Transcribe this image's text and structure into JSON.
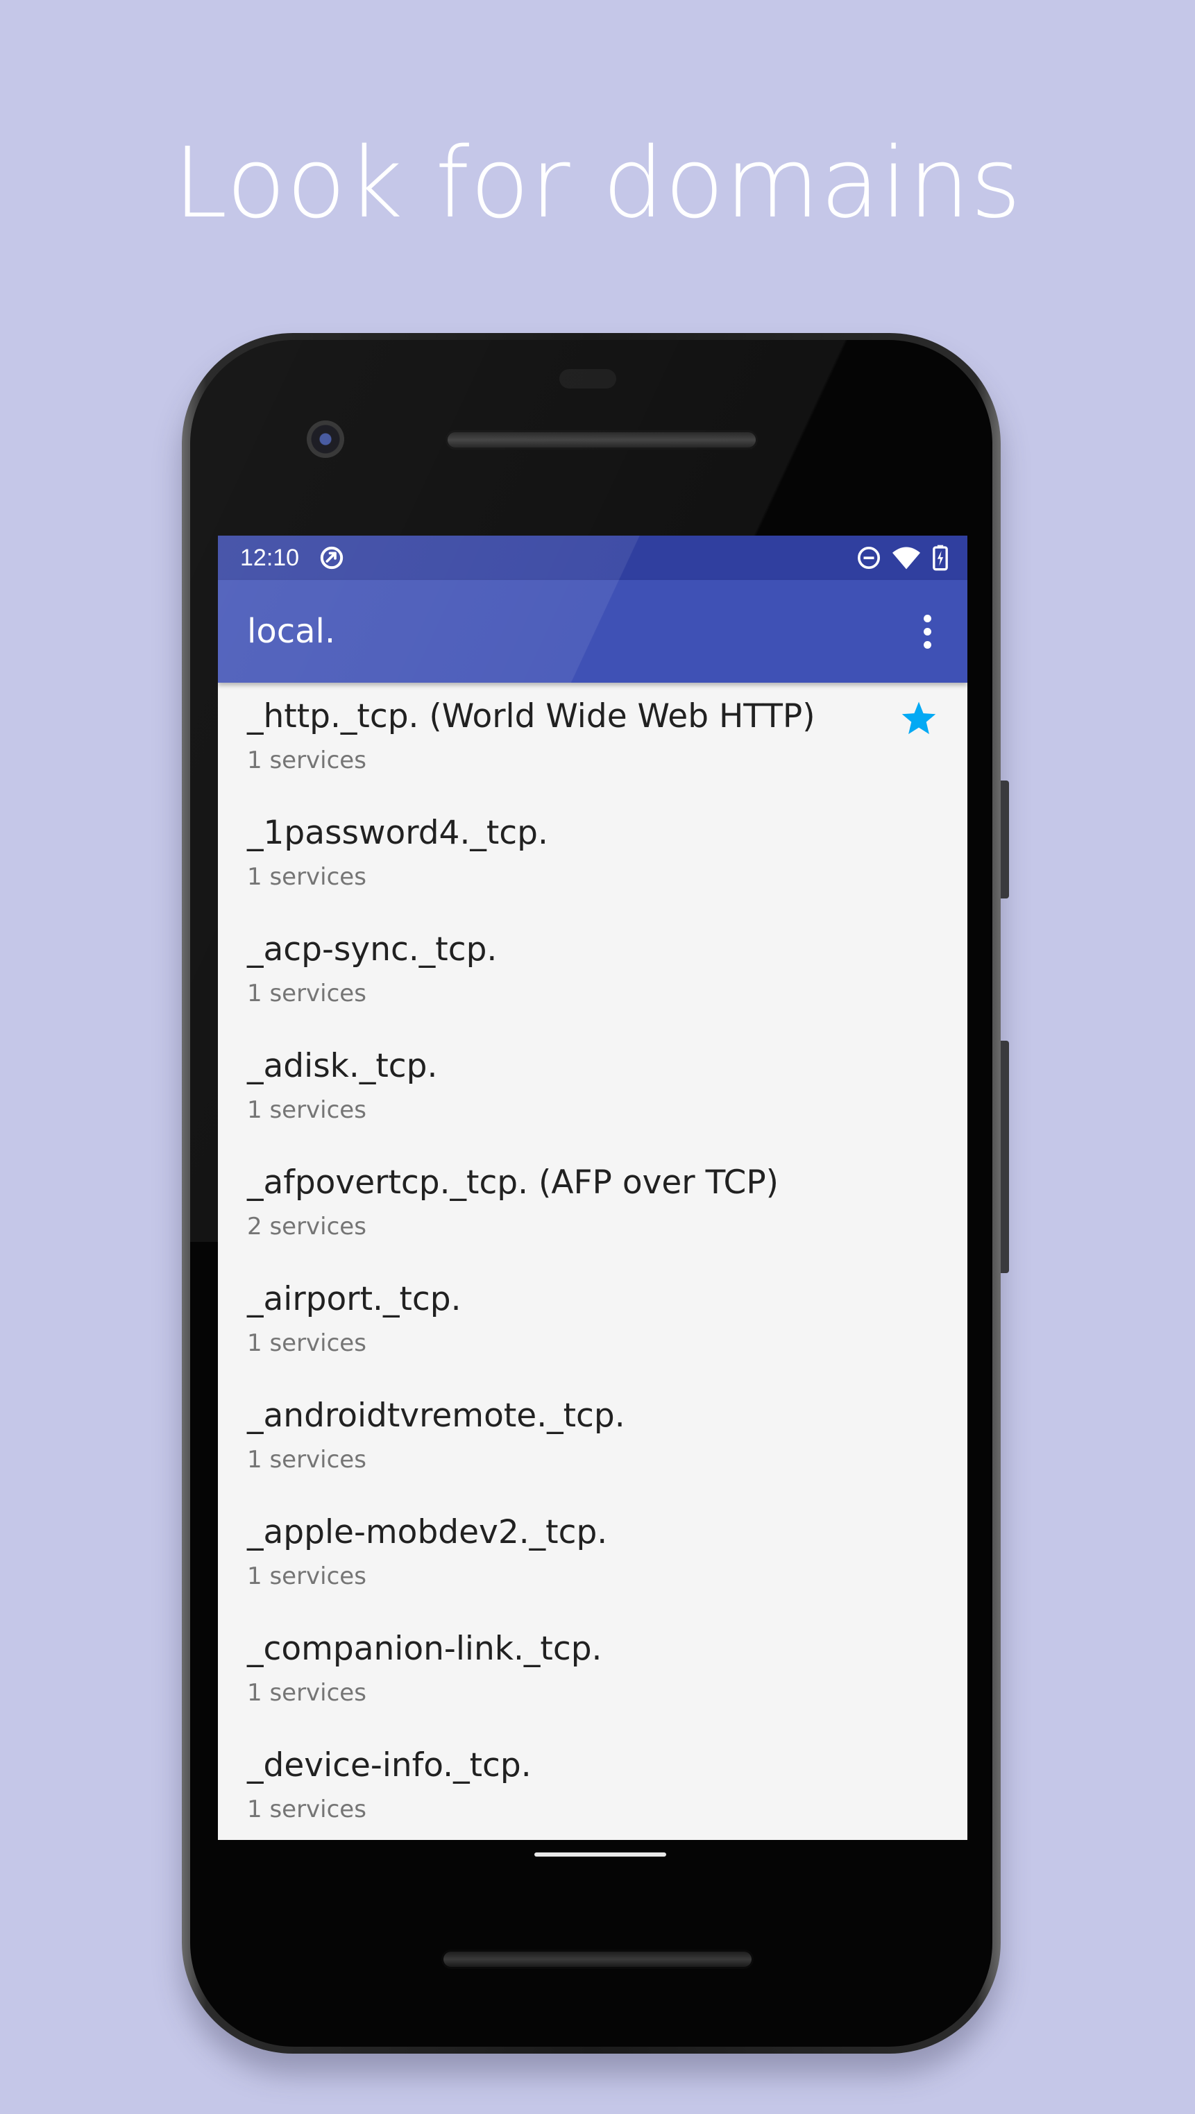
{
  "headline": "Look for domains",
  "status_bar": {
    "time": "12:10",
    "icons": [
      "sync-icon",
      "do-not-disturb-icon",
      "wifi-icon",
      "battery-charging-icon"
    ]
  },
  "toolbar": {
    "title": "local.",
    "menu_icon": "more-vert-icon"
  },
  "colors": {
    "background": "#c5c7e8",
    "status_bar": "#303f9f",
    "toolbar": "#3f51b5",
    "list_background": "#f5f5f5",
    "star": "#03a9f4"
  },
  "list": {
    "items": [
      {
        "title": "_http._tcp. (World Wide Web HTTP)",
        "subtitle": "1 services",
        "favorite": true
      },
      {
        "title": "_1password4._tcp.",
        "subtitle": "1 services"
      },
      {
        "title": "_acp-sync._tcp.",
        "subtitle": "1 services"
      },
      {
        "title": "_adisk._tcp.",
        "subtitle": "1 services"
      },
      {
        "title": "_afpovertcp._tcp. (AFP over TCP)",
        "subtitle": "2 services"
      },
      {
        "title": "_airport._tcp.",
        "subtitle": "1 services"
      },
      {
        "title": "_androidtvremote._tcp.",
        "subtitle": "1 services"
      },
      {
        "title": "_apple-mobdev2._tcp.",
        "subtitle": "1 services"
      },
      {
        "title": "_companion-link._tcp.",
        "subtitle": "1 services"
      },
      {
        "title": "_device-info._tcp.",
        "subtitle": "1 services"
      }
    ]
  }
}
